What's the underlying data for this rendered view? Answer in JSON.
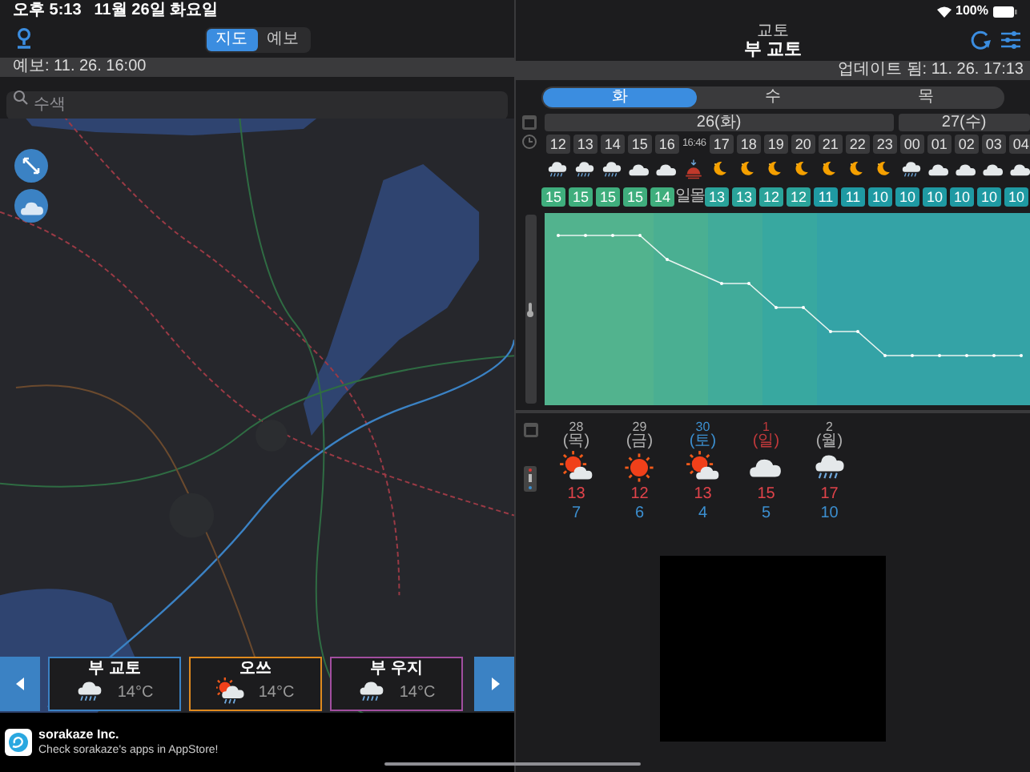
{
  "status_bar": {
    "time": "오후 5:13",
    "date": "11월 26일 화요일",
    "battery": "100%"
  },
  "left": {
    "mode_tabs": [
      {
        "label": "지도",
        "selected": true
      },
      {
        "label": "예보",
        "selected": false
      }
    ],
    "forecast_time": "예보: 11. 26. 16:00",
    "search": {
      "placeholder": "수색"
    },
    "cards": [
      {
        "name": "부 교토",
        "kind": "rain",
        "temp": "14°C",
        "color": "#3b82c4"
      },
      {
        "name": "오쓰",
        "kind": "sun_rain",
        "temp": "14°C",
        "color": "#e08a1e"
      },
      {
        "name": "부 우지",
        "kind": "rain",
        "temp": "14°C",
        "color": "#a24ea0"
      }
    ],
    "ad": {
      "title": "sorakaze Inc.",
      "text": "Check sorakaze's apps in AppStore!"
    }
  },
  "right": {
    "prefecture": "교토",
    "city": "부 교토",
    "updated": "업데이트 됨: 11. 26. 17:13",
    "day_tabs": [
      {
        "label": "화",
        "selected": true
      },
      {
        "label": "수",
        "selected": false
      },
      {
        "label": "목",
        "selected": false
      }
    ],
    "hourly": [
      {
        "day": "26(화)",
        "hours": [
          {
            "time": "12",
            "kind": "rain",
            "temp": "15"
          },
          {
            "time": "13",
            "kind": "rain",
            "temp": "15"
          },
          {
            "time": "14",
            "kind": "rain",
            "temp": "15"
          },
          {
            "time": "15",
            "kind": "cloud",
            "temp": "15"
          },
          {
            "time": "16",
            "kind": "cloud",
            "temp": "14"
          },
          {
            "time": "16:46",
            "kind": "sunset",
            "temp": "일몰"
          },
          {
            "time": "17",
            "kind": "moon",
            "temp": "13"
          },
          {
            "time": "18",
            "kind": "moon",
            "temp": "13"
          },
          {
            "time": "19",
            "kind": "moon",
            "temp": "12"
          },
          {
            "time": "20",
            "kind": "moon",
            "temp": "12"
          },
          {
            "time": "21",
            "kind": "moon",
            "temp": "11"
          },
          {
            "time": "22",
            "kind": "moon",
            "temp": "11"
          },
          {
            "time": "23",
            "kind": "moon",
            "temp": "10"
          }
        ]
      },
      {
        "day": "27(수)",
        "hours": [
          {
            "time": "00",
            "kind": "rain",
            "temp": "10"
          },
          {
            "time": "01",
            "kind": "cloud",
            "temp": "10"
          },
          {
            "time": "02",
            "kind": "cloud",
            "temp": "10"
          },
          {
            "time": "03",
            "kind": "cloud",
            "temp": "10"
          },
          {
            "time": "04",
            "kind": "cloud",
            "temp": "10"
          }
        ]
      }
    ],
    "daily": [
      {
        "date": "28",
        "weekday": "(목)",
        "color": "#b0b0b0",
        "kind": "sun_cloud",
        "high": "13",
        "low": "7"
      },
      {
        "date": "29",
        "weekday": "(금)",
        "color": "#b0b0b0",
        "kind": "sun",
        "high": "12",
        "low": "6"
      },
      {
        "date": "30",
        "weekday": "(토)",
        "color": "#3c8fd0",
        "kind": "sun_cloud",
        "high": "13",
        "low": "4"
      },
      {
        "date": "1",
        "weekday": "(일)",
        "color": "#c0393b",
        "kind": "cloud",
        "high": "15",
        "low": "5"
      },
      {
        "date": "2",
        "weekday": "(월)",
        "color": "#b0b0b0",
        "kind": "rain",
        "high": "17",
        "low": "10"
      }
    ]
  }
}
